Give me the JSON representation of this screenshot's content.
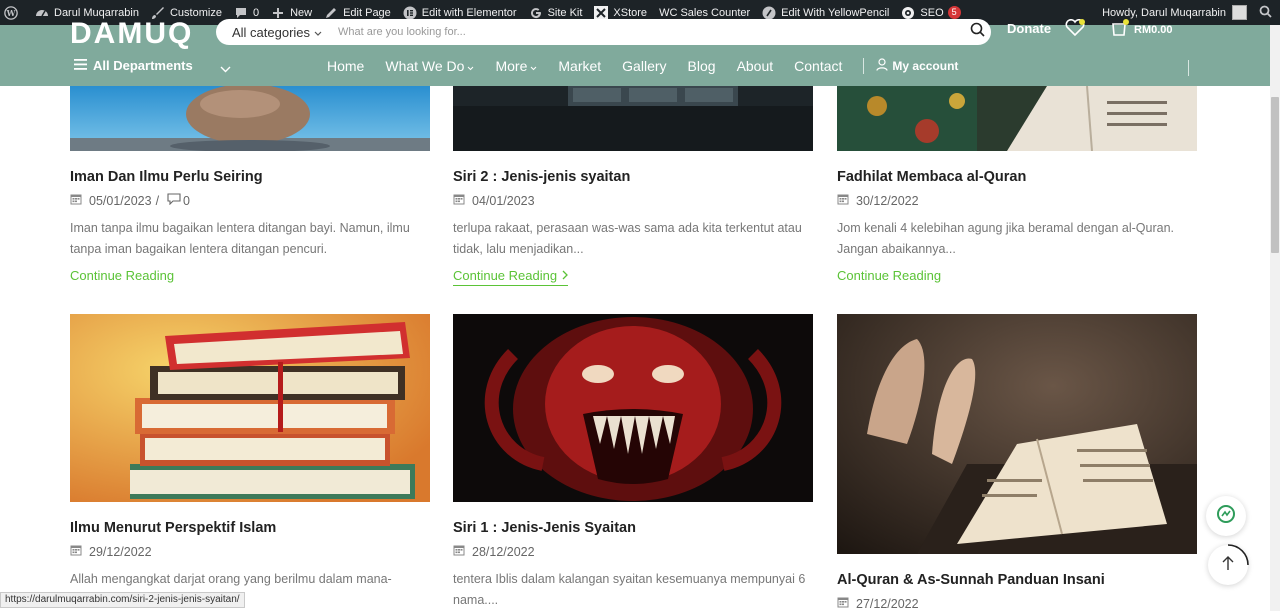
{
  "adminbar": {
    "site_name": "Darul Muqarrabin",
    "customize": "Customize",
    "comments_count": "0",
    "new": "New",
    "edit_page": "Edit Page",
    "edit_elementor": "Edit with Elementor",
    "site_kit": "Site Kit",
    "xstore": "XStore",
    "wc_sales": "WC Sales Counter",
    "yellowpencil": "Edit With YellowPencil",
    "seo": "SEO",
    "seo_badge": "5",
    "howdy": "Howdy, Darul Muqarrabin"
  },
  "header": {
    "logo": "DAMUQ",
    "search_category": "All categories",
    "search_placeholder": "What are you looking for...",
    "donate": "Donate",
    "cart_total": "RM0.00",
    "all_departments": "All Departments",
    "nav": [
      {
        "label": "Home"
      },
      {
        "label": "What We Do"
      },
      {
        "label": "More"
      },
      {
        "label": "Market"
      },
      {
        "label": "Gallery"
      },
      {
        "label": "Blog"
      },
      {
        "label": "About"
      },
      {
        "label": "Contact"
      }
    ],
    "my_account": "My account",
    "header_color": "#80aa9c"
  },
  "posts": [
    {
      "title": "Iman Dan Ilmu Perlu Seiring",
      "date": "05/01/2023",
      "comments": "0",
      "excerpt": "Iman tanpa ilmu bagaikan lentera ditangan bayi. Namun, ilmu tanpa iman bagaikan lentera ditangan pencuri.",
      "read_more": "Continue Reading"
    },
    {
      "title": "Siri 2 : Jenis-jenis syaitan",
      "date": "04/01/2023",
      "excerpt": "terlupa rakaat, perasaan was-was sama ada kita terkentut atau tidak, lalu menjadikan...",
      "read_more": "Continue Reading"
    },
    {
      "title": "Fadhilat Membaca al-Quran",
      "date": "30/12/2022",
      "excerpt": "Jom kenali 4 kelebihan agung jika beramal dengan al-Quran. Jangan abaikannya...",
      "read_more": "Continue Reading"
    },
    {
      "title": "Ilmu Menurut Perspektif Islam",
      "date": "29/12/2022",
      "excerpt": "Allah mengangkat darjat orang yang berilmu dalam mana-"
    },
    {
      "title": "Siri 1 : Jenis-Jenis Syaitan",
      "date": "28/12/2022",
      "excerpt": "tentera Iblis dalam kalangan syaitan kesemuanya mempunyai 6 nama...."
    },
    {
      "title": "Al-Quran & As-Sunnah Panduan Insani",
      "date": "27/12/2022"
    }
  ],
  "status_url": "https://darulmuqarrabin.com/siri-2-jenis-jenis-syaitan/",
  "colors": {
    "accent_green": "#5bc337",
    "admin_bar": "#1d2327"
  }
}
